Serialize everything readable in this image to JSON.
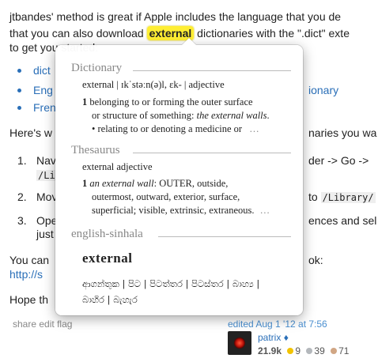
{
  "answer": {
    "line1": "jtbandes' method is great if Apple includes the language that you de",
    "line2_pre": "that you can also download",
    "highlight_word": "external",
    "line2_post": "dictionaries with the \".dict\" exte",
    "line3": "to get you started:",
    "links": [
      "dict",
      "Eng",
      "Fren"
    ],
    "link_right": "ionary",
    "line_heres": "Here's w",
    "line_heres_right": "naries you wa",
    "step1_num": "1.",
    "step1_a": "Nav",
    "step1_a_right": "der -> Go ->",
    "step1_b": "/Li",
    "step2_num": "2.",
    "step2_a": "Mov",
    "step2_right": "/Library/",
    "step3_num": "3.",
    "step3_a": "Ope",
    "step3_right": "ences and sel",
    "step3_b": "just",
    "line_youcan": "You can",
    "line_youcan_right": "ok:",
    "url_partial": "http://s",
    "line_hope": "Hope th"
  },
  "post_meta": {
    "share": "share",
    "edit": "edit",
    "flag": "flag",
    "edited": "edited Aug 1 '12 at 7:56",
    "user_name": "patrix",
    "user_diamond": "♦",
    "reputation": "21.9k",
    "gold": "9",
    "silver": "39",
    "bronze": "71"
  },
  "popover": {
    "dictionary": {
      "header": "Dictionary",
      "pron": "external | ɪkˈstəːn(ə)l,  ɛk- | adjective",
      "sense_num": "1",
      "sense_l1": "belonging to or forming the outer surface",
      "sense_l2_a": "or structure of something:",
      "sense_l2_ex": "the external walls",
      "sense_l2_end": ".",
      "sense_l3": "• relating to or denoting a medicine or",
      "ellipsis": "…"
    },
    "thesaurus": {
      "header": "Thesaurus",
      "pos": "external adjective",
      "num": "1",
      "ex": "an external wall",
      "l1_rest": ": OUTER, outside,",
      "l2": "outermost, outward, exterior, surface,",
      "l3": "superficial; visible, extrinsic, extraneous.",
      "ellipsis": "…"
    },
    "sinhala": {
      "header": "english-sinhala",
      "headword": "external",
      "l1": "ආගන්තුක  |  පිට  |  පිටත්තර  |  පිටස්තර  |  බාහ්‍ය  |",
      "l2": "බාහිර  |  බැහැර"
    }
  },
  "colors": {
    "highlight": "#ffee33",
    "link": "#2a6fb8",
    "gold": "#f2c300",
    "silver": "#b4b8bc",
    "bronze": "#d1a684"
  }
}
